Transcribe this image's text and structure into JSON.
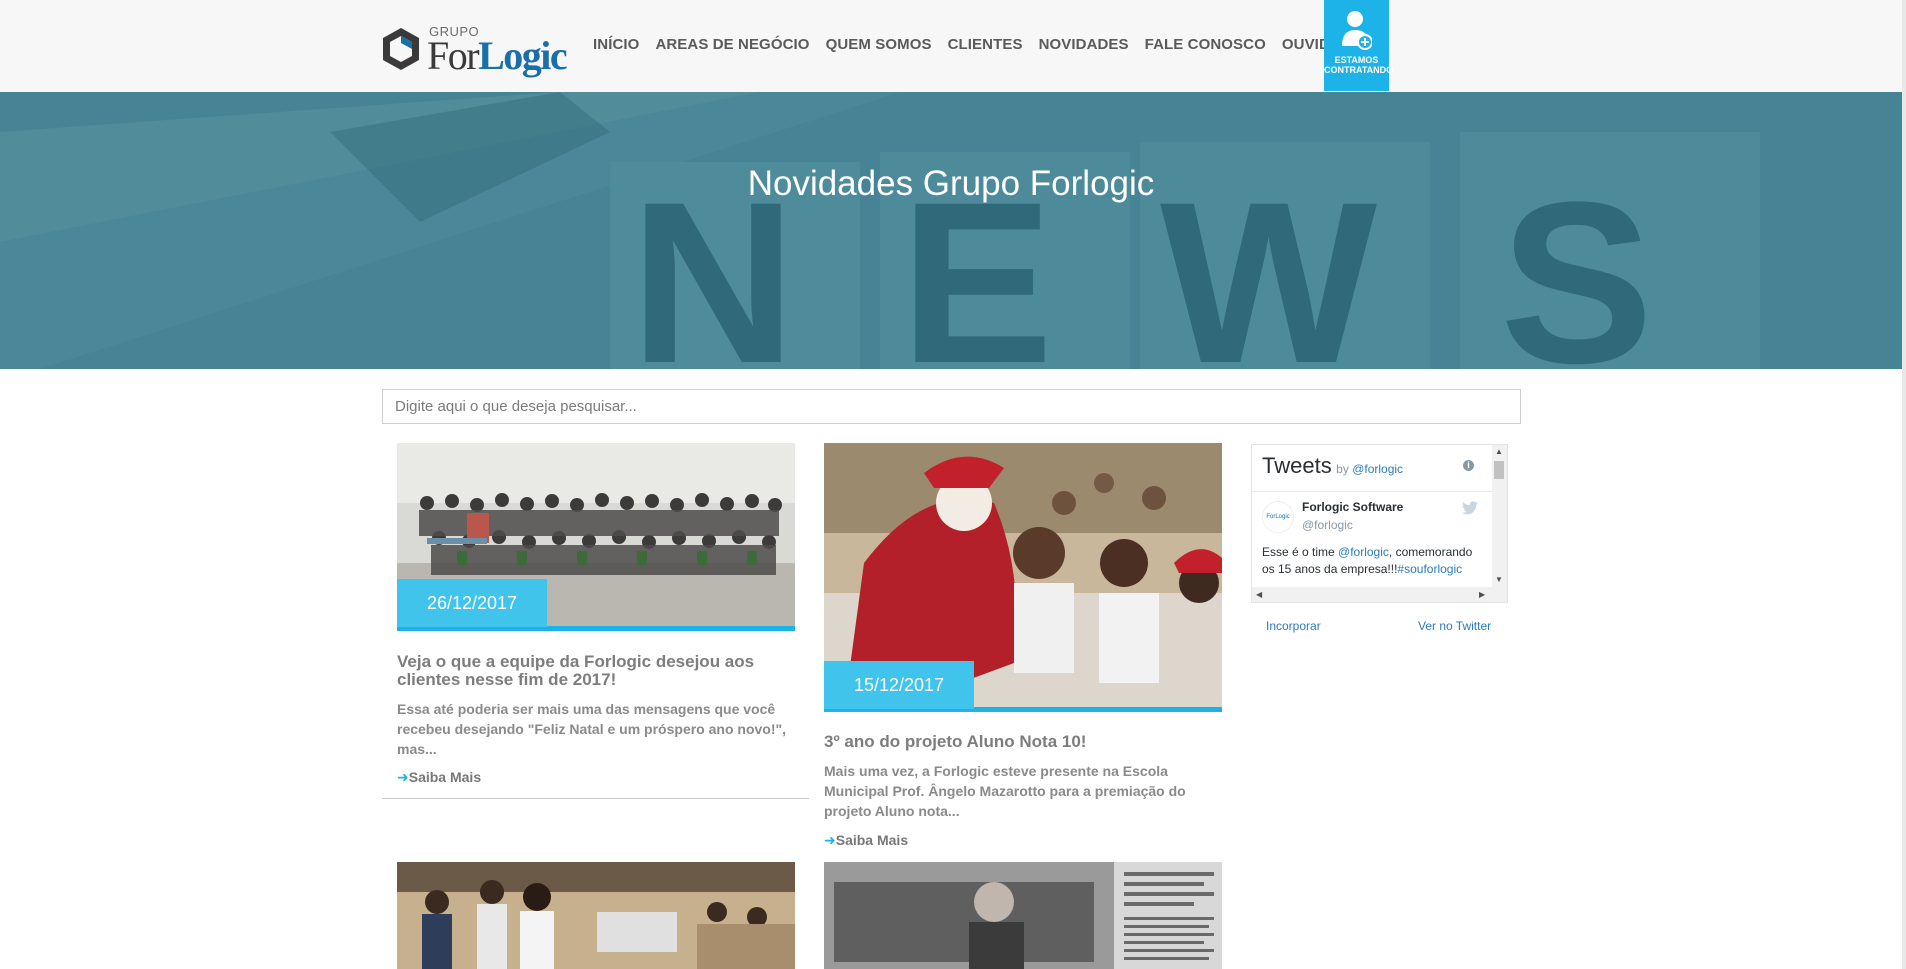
{
  "header": {
    "logo_group": "GRUPO",
    "logo_for": "For",
    "logo_logic": "Logic",
    "nav": [
      "INÍCIO",
      "AREAS DE NEGÓCIO",
      "QUEM SOMOS",
      "CLIENTES",
      "NOVIDADES",
      "FALE CONOSCO",
      "OUVIDORIA"
    ],
    "hiring_line1": "ESTAMOS",
    "hiring_line2": "CONTRATANDO",
    "accent_color": "#1eb3e8"
  },
  "hero": {
    "title": "Novidades Grupo Forlogic"
  },
  "search": {
    "placeholder": "Digite aqui o que deseja pesquisar..."
  },
  "posts": [
    {
      "date": "26/12/2017",
      "title": "Veja o que a equipe da Forlogic desejou aos clientes nesse fim de 2017!",
      "excerpt": "Essa até poderia ser mais uma das mensagens que você recebeu desejando \"Feliz Natal e um próspero ano novo!\", mas...",
      "more": "Saiba Mais"
    },
    {
      "date": "15/12/2017",
      "title": "3º ano do projeto Aluno Nota 10!",
      "excerpt": "Mais uma vez, a Forlogic esteve presente na Escola Municipal Prof. Ângelo Mazarotto para a premiação do projeto Aluno nota...",
      "more": "Saiba Mais"
    }
  ],
  "twitter": {
    "title": "Tweets",
    "by": "by",
    "by_handle": "@forlogic",
    "account_name": "Forlogic Software",
    "account_handle": "@forlogic",
    "tweet_pre": "Esse é o time ",
    "tweet_mention": "@forlogic",
    "tweet_mid": ", comemorando os 15 anos da empresa!!!",
    "tweet_hashtag": "#souforlogic",
    "embed": "Incorporar",
    "view": "Ver no Twitter"
  }
}
